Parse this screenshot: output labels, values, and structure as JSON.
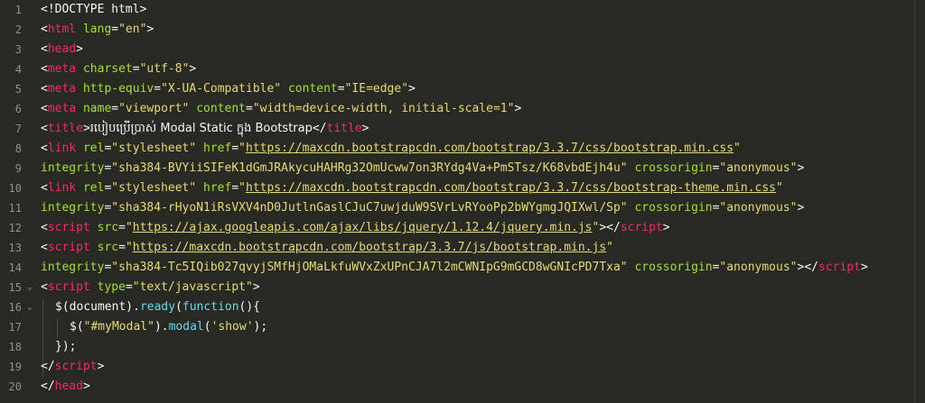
{
  "colors": {
    "background": "#282923",
    "gutter_text": "#90908a",
    "tag": "#f92672",
    "attribute": "#a6e22e",
    "string": "#e6db74",
    "plain": "#f8f8f2",
    "method": "#66d9ef"
  },
  "gutter": [
    "1",
    "2",
    "3",
    "4",
    "5",
    "6",
    "7",
    "8",
    "9",
    "10",
    "11",
    "12",
    "13",
    "14",
    "15",
    "16",
    "17",
    "18",
    "19",
    "20"
  ],
  "fold_markers": {
    "15": "fold-open-icon",
    "16": "fold-open-icon"
  },
  "code": {
    "l1": {
      "doctype": "<!DOCTYPE html>"
    },
    "l2": {
      "open": "<",
      "tag": "html",
      "attr": "lang",
      "eq": "=",
      "val": "\"en\"",
      "close": ">"
    },
    "l3": {
      "open": "<",
      "tag": "head",
      "close": ">"
    },
    "l4": {
      "open": "<",
      "tag": "meta",
      "attr": "charset",
      "eq": "=",
      "val": "\"utf-8\"",
      "close": ">"
    },
    "l5": {
      "open": "<",
      "tag": "meta",
      "attr1": "http-equiv",
      "eq1": "=",
      "val1": "\"X-UA-Compatible\"",
      "attr2": "content",
      "eq2": "=",
      "val2": "\"IE=edge\"",
      "close": ">"
    },
    "l6": {
      "open": "<",
      "tag": "meta",
      "attr1": "name",
      "eq1": "=",
      "val1": "\"viewport\"",
      "attr2": "content",
      "eq2": "=",
      "val2": "\"width=device-width, initial-scale=1\"",
      "close": ">"
    },
    "l7": {
      "open": "<",
      "tag": "title",
      "close": ">",
      "text": "របៀបប្រើប្រាស់ Modal Static ក្នុង Bootstrap",
      "end_open": "</",
      "end_tag": "title",
      "end_close": ">"
    },
    "l8": {
      "open": "<",
      "tag": "link",
      "attr1": "rel",
      "eq1": "=",
      "val1": "\"stylesheet\"",
      "attr2": "href",
      "eq2": "=",
      "q1": "\"",
      "url": "https://maxcdn.bootstrapcdn.com/bootstrap/3.3.7/css/bootstrap.min.css",
      "q2": "\""
    },
    "l9": {
      "attr1": "integrity",
      "eq1": "=",
      "val1": "\"sha384-BVYiiSIFeK1dGmJRAkycuHAHRg32OmUcww7on3RYdg4Va+PmSTsz/K68vbdEjh4u\"",
      "attr2": "crossorigin",
      "eq2": "=",
      "val2": "\"anonymous\"",
      "close": ">"
    },
    "l10": {
      "open": "<",
      "tag": "link",
      "attr1": "rel",
      "eq1": "=",
      "val1": "\"stylesheet\"",
      "attr2": "href",
      "eq2": "=",
      "q1": "\"",
      "url": "https://maxcdn.bootstrapcdn.com/bootstrap/3.3.7/css/bootstrap-theme.min.css",
      "q2": "\""
    },
    "l11": {
      "attr1": "integrity",
      "eq1": "=",
      "val1": "\"sha384-rHyoN1iRsVXV4nD0JutlnGaslCJuC7uwjduW9SVrLvRYooPp2bWYgmgJQIXwl/Sp\"",
      "attr2": "crossorigin",
      "eq2": "=",
      "val2": "\"anonymous\"",
      "close": ">"
    },
    "l12": {
      "open": "<",
      "tag": "script",
      "attr": "src",
      "eq": "=",
      "q1": "\"",
      "url": "https://ajax.googleapis.com/ajax/libs/jquery/1.12.4/jquery.min.js",
      "q2": "\"",
      "close": ">",
      "end_open": "</",
      "end_tag": "script",
      "end_close": ">"
    },
    "l13": {
      "open": "<",
      "tag": "script",
      "attr": "src",
      "eq": "=",
      "q1": "\"",
      "url": "https://maxcdn.bootstrapcdn.com/bootstrap/3.3.7/js/bootstrap.min.js",
      "q2": "\""
    },
    "l14": {
      "attr1": "integrity",
      "eq1": "=",
      "val1": "\"sha384-Tc5IQib027qvyjSMfHjOMaLkfuWVxZxUPnCJA7l2mCWNIpG9mGCD8wGNIcPD7Txa\"",
      "attr2": "crossorigin",
      "eq2": "=",
      "val2": "\"anonymous\"",
      "close": ">",
      "end_open": "</",
      "end_tag": "script",
      "end_close": ">"
    },
    "l15": {
      "open": "<",
      "tag": "script",
      "attr": "type",
      "eq": "=",
      "val": "\"text/javascript\"",
      "close": ">"
    },
    "l16": {
      "dollar": "$",
      "paren_open": "(",
      "obj": "document",
      "paren_close": ")",
      "dot": ".",
      "method": "ready",
      "p2": "(",
      "kw": "function",
      "rest": "(){"
    },
    "l17": {
      "dollar": "$",
      "paren_open": "(",
      "val": "\"#myModal\"",
      "paren_close": ")",
      "dot": ".",
      "method": "modal",
      "p2": "(",
      "val2": "'show'",
      "rest": ");"
    },
    "l18": {
      "text": "});"
    },
    "l19": {
      "end_open": "</",
      "end_tag": "script",
      "end_close": ">"
    },
    "l20": {
      "end_open": "</",
      "end_tag": "head",
      "end_close": ">"
    }
  }
}
